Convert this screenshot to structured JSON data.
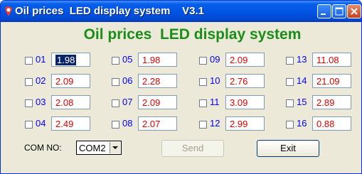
{
  "window": {
    "title": "Oil prices  LED display system    V3.1"
  },
  "heading": "Oil prices  LED display system",
  "channels": [
    {
      "num": "01",
      "value": "1.98"
    },
    {
      "num": "02",
      "value": "2.09"
    },
    {
      "num": "03",
      "value": "2.08"
    },
    {
      "num": "04",
      "value": "2.49"
    },
    {
      "num": "05",
      "value": "1.98"
    },
    {
      "num": "06",
      "value": "2.28"
    },
    {
      "num": "07",
      "value": "2.09"
    },
    {
      "num": "08",
      "value": "2.07"
    },
    {
      "num": "09",
      "value": "2.09"
    },
    {
      "num": "10",
      "value": "2.76"
    },
    {
      "num": "11",
      "value": "3.09"
    },
    {
      "num": "12",
      "value": "2.99"
    },
    {
      "num": "13",
      "value": "11.08"
    },
    {
      "num": "14",
      "value": "21.09"
    },
    {
      "num": "15",
      "value": "2.89"
    },
    {
      "num": "16",
      "value": "0.88"
    }
  ],
  "com": {
    "label": "COM NO:",
    "selected": "COM2"
  },
  "buttons": {
    "send": "Send",
    "exit": "Exit"
  },
  "colors": {
    "heading": "#1a8d1a",
    "channel_number": "#0000ff",
    "value_text": "#e00000",
    "titlebar": "#0055e5"
  }
}
